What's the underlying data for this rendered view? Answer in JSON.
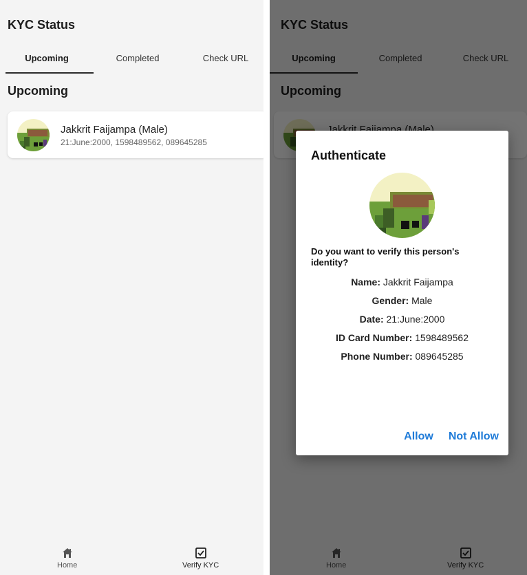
{
  "app": {
    "title": "KYC Status"
  },
  "tabs": [
    {
      "label": "Upcoming",
      "active": true
    },
    {
      "label": "Completed",
      "active": false
    },
    {
      "label": "Check URL",
      "active": false
    }
  ],
  "section_title": "Upcoming",
  "list": [
    {
      "name": "Jakkrit Faijampa (Male)",
      "details": "21:June:2000, 1598489562, 089645285"
    }
  ],
  "dialog": {
    "title": "Authenticate",
    "question": "Do you want to verify this person's identity?",
    "fields": [
      {
        "label": "Name:",
        "value": "Jakkrit Faijampa"
      },
      {
        "label": "Gender:",
        "value": "Male"
      },
      {
        "label": "Date:",
        "value": "21:June:2000"
      },
      {
        "label": "ID Card Number:",
        "value": "1598489562"
      },
      {
        "label": "Phone Number:",
        "value": "089645285"
      }
    ],
    "allow_label": "Allow",
    "deny_label": "Not Allow"
  },
  "nav": {
    "home_label": "Home",
    "home_icon": "home-icon",
    "verify_label": "Verify KYC",
    "verify_icon": "checkbox-icon"
  },
  "colors": {
    "accent": "#1f7bd8",
    "overlay": "#000000",
    "background": "#f4f4f4"
  }
}
